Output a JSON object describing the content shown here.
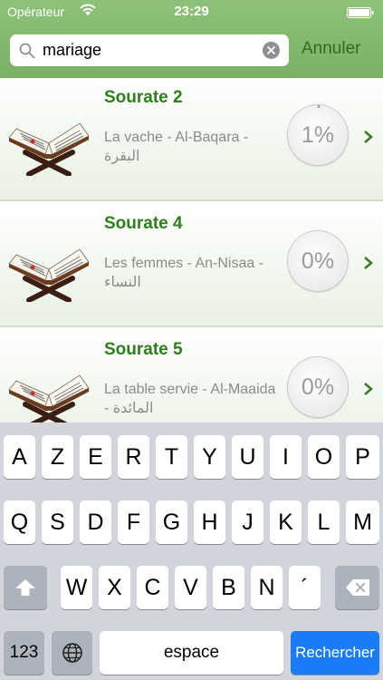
{
  "status_bar": {
    "carrier": "Opérateur",
    "time": "23:29"
  },
  "search": {
    "value": "mariage",
    "cancel_label": "Annuler"
  },
  "results": [
    {
      "title": "Sourate 2",
      "subtitle": "La vache  - Al-Baqara - البقرة",
      "progress": "1%",
      "progress_value": 0.01
    },
    {
      "title": "Sourate 4",
      "subtitle": "Les femmes  - An-Nisaa - النساء",
      "progress": "0%",
      "progress_value": 0
    },
    {
      "title": "Sourate 5",
      "subtitle": "La table servie  - Al-Maaida - المائدة",
      "progress": "0%",
      "progress_value": 0
    }
  ],
  "keyboard": {
    "row1": [
      "A",
      "Z",
      "E",
      "R",
      "T",
      "Y",
      "U",
      "I",
      "O",
      "P"
    ],
    "row2": [
      "Q",
      "S",
      "D",
      "F",
      "G",
      "H",
      "J",
      "K",
      "L",
      "M"
    ],
    "row3": [
      "W",
      "X",
      "C",
      "V",
      "B",
      "N",
      "´"
    ],
    "numbers_label": "123",
    "space_label": "espace",
    "return_label": "Rechercher"
  },
  "colors": {
    "header_green": "#79b066",
    "title_green": "#2e7d1e",
    "return_blue": "#1a7cf6"
  }
}
